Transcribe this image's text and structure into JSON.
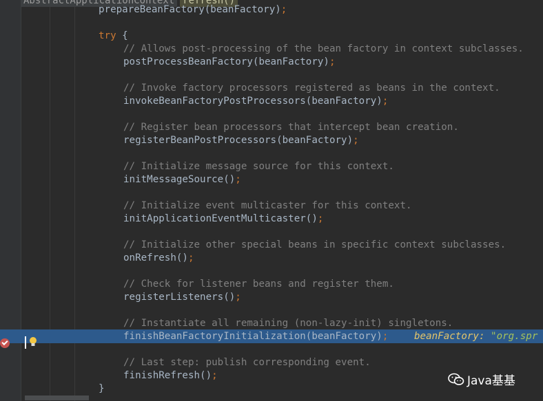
{
  "breadcrumbs": [
    "AbstractApplicationContext",
    "refresh()"
  ],
  "code_lines": [
    {
      "kind": "code",
      "text": "prepareBeanFactory(beanFactory)"
    },
    {
      "kind": "blank"
    },
    {
      "kind": "try",
      "text": "try {"
    },
    {
      "kind": "comment",
      "text": "// Allows post-processing of the bean factory in context subclasses."
    },
    {
      "kind": "code",
      "text": "postProcessBeanFactory(beanFactory)"
    },
    {
      "kind": "blank"
    },
    {
      "kind": "comment",
      "text": "// Invoke factory processors registered as beans in the context."
    },
    {
      "kind": "code",
      "text": "invokeBeanFactoryPostProcessors(beanFactory)"
    },
    {
      "kind": "blank"
    },
    {
      "kind": "comment",
      "text": "// Register bean processors that intercept bean creation."
    },
    {
      "kind": "code",
      "text": "registerBeanPostProcessors(beanFactory)"
    },
    {
      "kind": "blank"
    },
    {
      "kind": "comment",
      "text": "// Initialize message source for this context."
    },
    {
      "kind": "code",
      "text": "initMessageSource()"
    },
    {
      "kind": "blank"
    },
    {
      "kind": "comment",
      "text": "// Initialize event multicaster for this context."
    },
    {
      "kind": "code",
      "text": "initApplicationEventMulticaster()"
    },
    {
      "kind": "blank"
    },
    {
      "kind": "comment",
      "text": "// Initialize other special beans in specific context subclasses."
    },
    {
      "kind": "code",
      "text": "onRefresh()"
    },
    {
      "kind": "blank"
    },
    {
      "kind": "comment",
      "text": "// Check for listener beans and register them."
    },
    {
      "kind": "code",
      "text": "registerListeners()"
    },
    {
      "kind": "blank"
    },
    {
      "kind": "comment",
      "text": "// Instantiate all remaining (non-lazy-init) singletons."
    },
    {
      "kind": "current",
      "text": "finishBeanFactoryInitialization(beanFactory)"
    },
    {
      "kind": "blank"
    },
    {
      "kind": "comment",
      "text": "// Last step: publish corresponding event."
    },
    {
      "kind": "code",
      "text": "finishRefresh()"
    },
    {
      "kind": "close",
      "text": "}"
    }
  ],
  "semicolon": ";",
  "debug_hint": {
    "name": "beanFactory:",
    "value": "\"org.spr"
  },
  "watermark": {
    "icon": "wechat-icon",
    "text": "Java基基"
  },
  "colors": {
    "comment": "#808080",
    "keyword": "#cc7832",
    "code": "#a9b7c6",
    "highlight": "#2d5a8c",
    "breakpoint": "#c75450"
  }
}
